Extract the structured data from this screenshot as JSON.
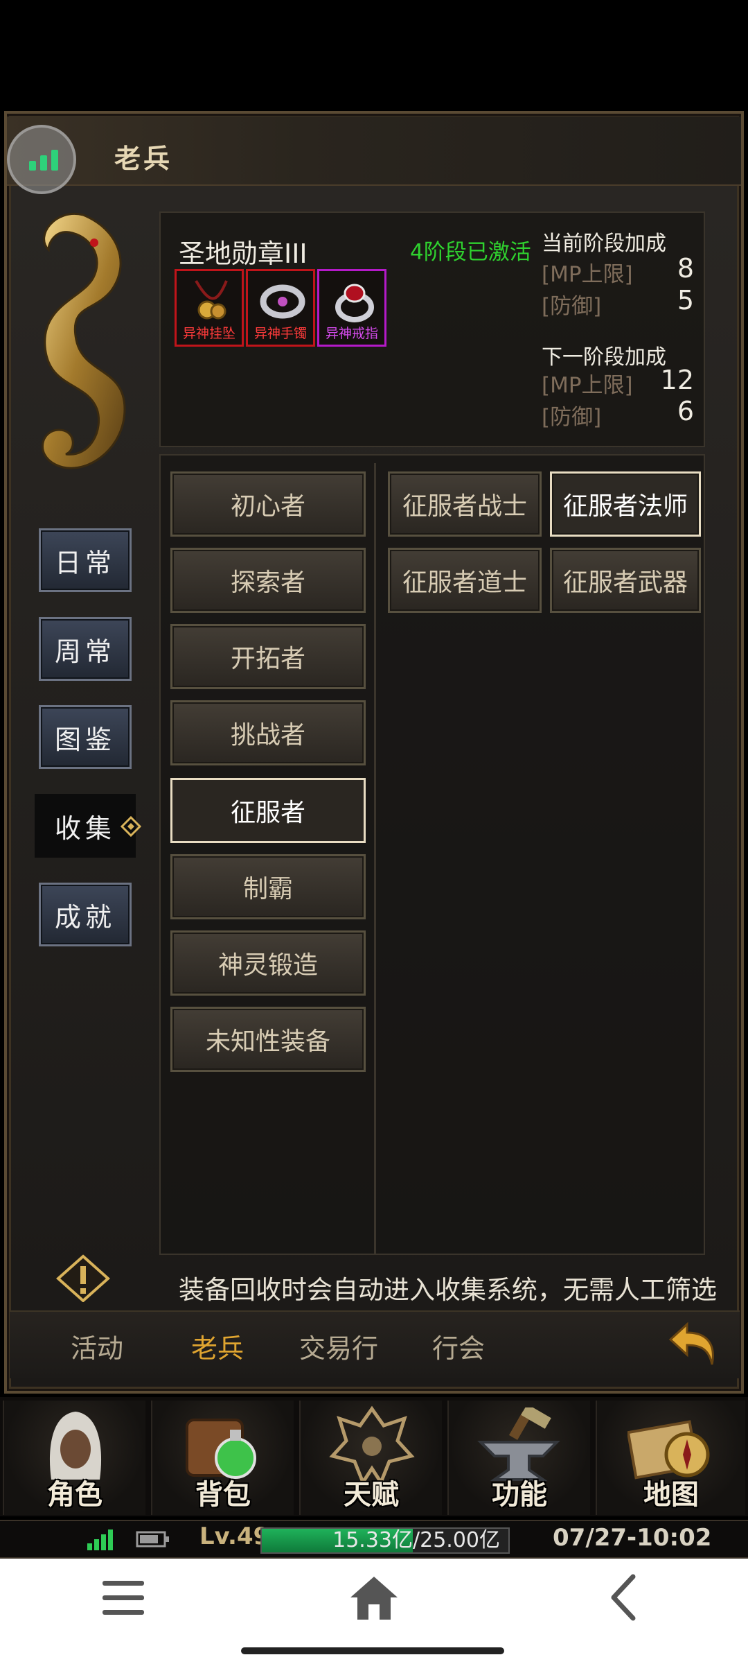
{
  "header": {
    "title": "老兵"
  },
  "side_tabs": [
    {
      "label": "日常",
      "active": false
    },
    {
      "label": "周常",
      "active": false
    },
    {
      "label": "图鉴",
      "active": false
    },
    {
      "label": "收集",
      "active": true
    },
    {
      "label": "成就",
      "active": false
    }
  ],
  "medal": {
    "name": "圣地勋章III",
    "status": "4阶段已激活",
    "items": [
      {
        "label": "异神挂坠",
        "border": "red"
      },
      {
        "label": "异神手镯",
        "border": "red"
      },
      {
        "label": "异神戒指",
        "border": "purple"
      }
    ],
    "current": {
      "heading": "当前阶段加成",
      "stats": [
        {
          "name": "[MP上限]",
          "value": "8"
        },
        {
          "name": "[防御]",
          "value": "5"
        }
      ]
    },
    "next": {
      "heading": "下一阶段加成",
      "stats": [
        {
          "name": "[MP上限]",
          "value": "12"
        },
        {
          "name": "[防御]",
          "value": "6"
        }
      ]
    }
  },
  "categories": [
    {
      "label": "初心者",
      "active": false
    },
    {
      "label": "探索者",
      "active": false
    },
    {
      "label": "开拓者",
      "active": false
    },
    {
      "label": "挑战者",
      "active": false
    },
    {
      "label": "征服者",
      "active": true
    },
    {
      "label": "制霸",
      "active": false
    },
    {
      "label": "神灵锻造",
      "active": false
    },
    {
      "label": "未知性装备",
      "active": false
    }
  ],
  "subcategories": [
    {
      "label": "征服者战士",
      "active": false
    },
    {
      "label": "征服者法师",
      "active": true
    },
    {
      "label": "征服者道士",
      "active": false
    },
    {
      "label": "征服者武器",
      "active": false
    }
  ],
  "tip": "装备回收时会自动进入收集系统，无需人工筛选",
  "bottom_tabs": [
    {
      "label": "活动",
      "active": false
    },
    {
      "label": "老兵",
      "active": true
    },
    {
      "label": "交易行",
      "active": false
    },
    {
      "label": "行会",
      "active": false
    }
  ],
  "main_nav": [
    {
      "label": "角色",
      "icon": "hooded-character-icon"
    },
    {
      "label": "背包",
      "icon": "bag-potion-icon"
    },
    {
      "label": "天赋",
      "icon": "dragon-crest-icon"
    },
    {
      "label": "功能",
      "icon": "anvil-hammer-icon"
    },
    {
      "label": "地图",
      "icon": "compass-map-icon"
    }
  ],
  "status": {
    "level": "Lv.49",
    "xp_text": "15.33亿/25.00亿",
    "xp_fraction": 0.613,
    "datetime": "07/27-10:02"
  },
  "colors": {
    "accent": "#e0a530",
    "activated_green": "#2fd22f",
    "xp_green": "#1fb25a"
  }
}
